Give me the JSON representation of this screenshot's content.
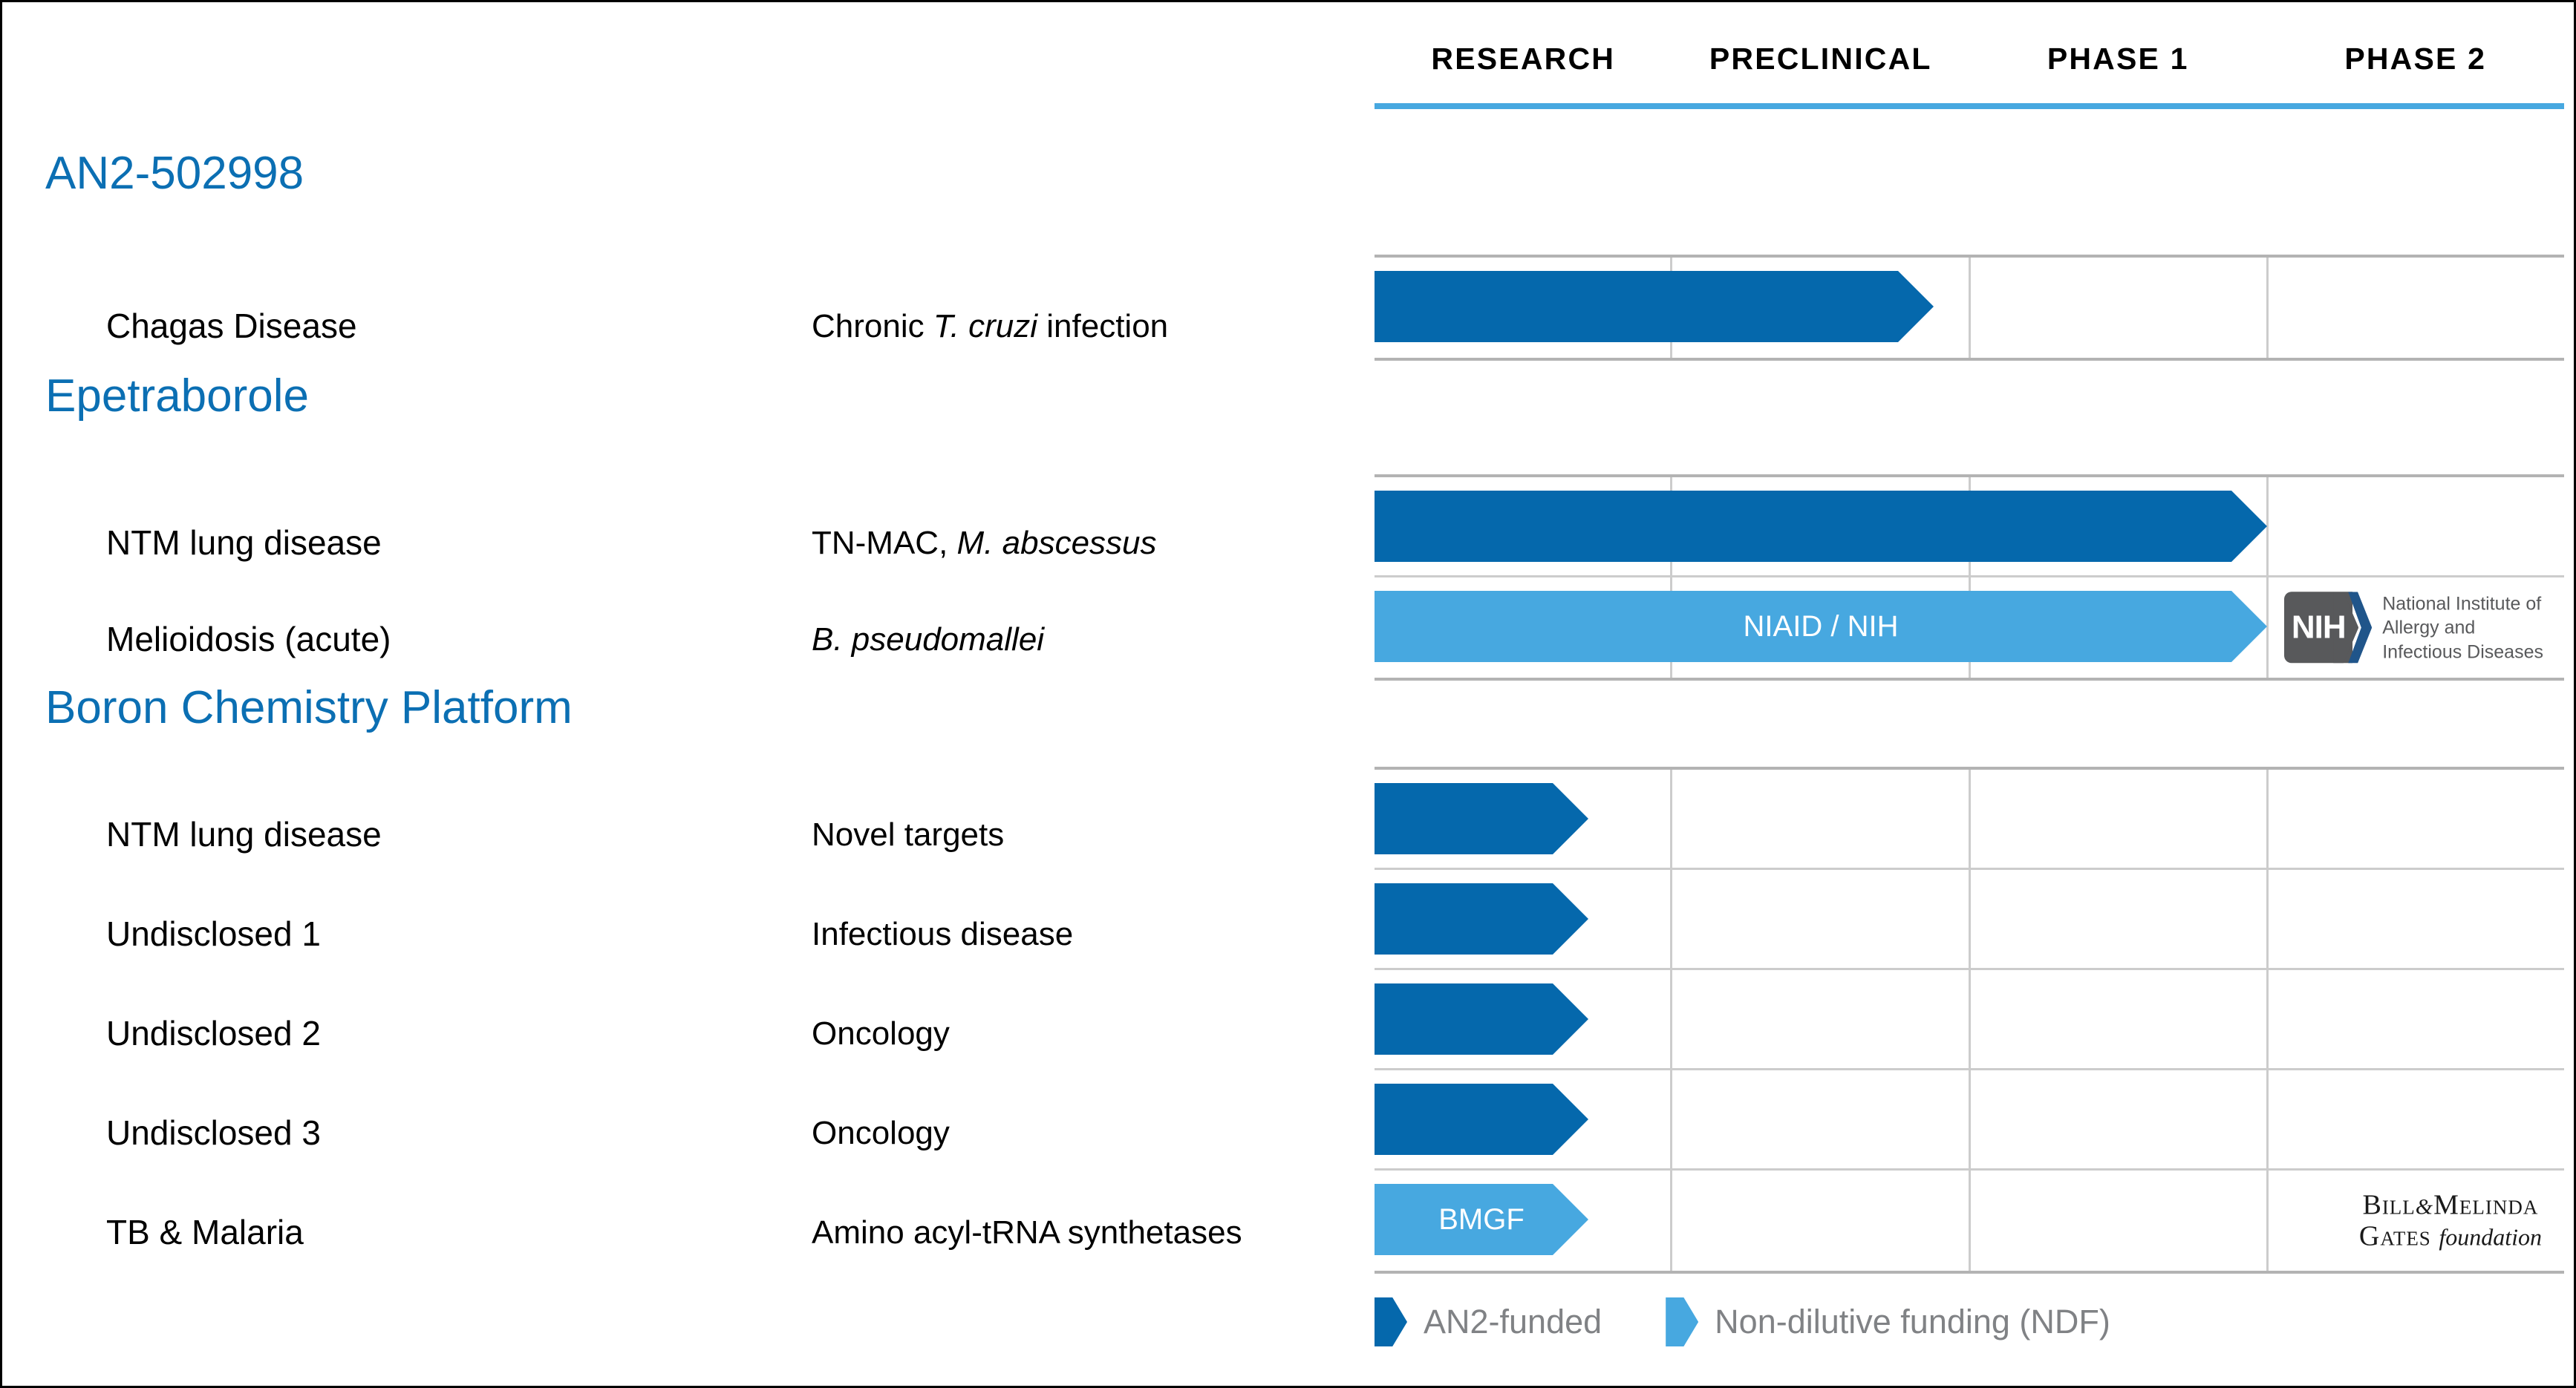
{
  "colors": {
    "an2_funded": "#0568AC",
    "non_dilutive": "#47A8E0",
    "program_title": "#0B6FB3",
    "header_underline": "#47A8E0",
    "grid_line": "#cccccc",
    "legend_text": "#808285"
  },
  "header": {
    "columns": [
      "RESEARCH",
      "PRECLINICAL",
      "PHASE 1",
      "PHASE 2"
    ]
  },
  "legend": {
    "items": [
      {
        "label": "AN2-funded",
        "color": "#0568AC"
      },
      {
        "label": "Non-dilutive funding (NDF)",
        "color": "#47A8E0"
      }
    ]
  },
  "logos": {
    "nih": {
      "badge": "NIH",
      "line1": "National Institute of",
      "line2": "Allergy and",
      "line3": "Infectious Diseases"
    },
    "gates": {
      "line1_a": "Bill",
      "line1_amp": "&",
      "line1_b": "Melinda",
      "line2_a": "Gates",
      "line2_b": "foundation"
    }
  },
  "programs": [
    {
      "title": "AN2-502998",
      "rows": [
        {
          "indication": "Chagas Disease",
          "detail_prefix": "Chronic ",
          "detail_italic": "T. cruzi",
          "detail_suffix": " infection",
          "bar": {
            "fill": "dark",
            "progress_pct": 47,
            "label": ""
          },
          "logo": ""
        }
      ]
    },
    {
      "title": "Epetraborole",
      "rows": [
        {
          "indication": "NTM lung disease",
          "detail_prefix": "TN-MAC, ",
          "detail_italic": "M. abscessus",
          "detail_suffix": "",
          "bar": {
            "fill": "dark",
            "progress_pct": 75,
            "label": ""
          },
          "logo": ""
        },
        {
          "indication": "Melioidosis (acute)",
          "detail_prefix": "",
          "detail_italic": "B. pseudomallei",
          "detail_suffix": "",
          "bar": {
            "fill": "light",
            "progress_pct": 75,
            "label": "NIAID / NIH"
          },
          "logo": "nih"
        }
      ]
    },
    {
      "title": "Boron Chemistry Platform",
      "rows": [
        {
          "indication": "NTM lung disease",
          "detail_prefix": "Novel targets",
          "detail_italic": "",
          "detail_suffix": "",
          "bar": {
            "fill": "dark",
            "progress_pct": 18,
            "label": ""
          },
          "logo": ""
        },
        {
          "indication": "Undisclosed 1",
          "detail_prefix": "Infectious disease",
          "detail_italic": "",
          "detail_suffix": "",
          "bar": {
            "fill": "dark",
            "progress_pct": 18,
            "label": ""
          },
          "logo": ""
        },
        {
          "indication": "Undisclosed 2",
          "detail_prefix": "Oncology",
          "detail_italic": "",
          "detail_suffix": "",
          "bar": {
            "fill": "dark",
            "progress_pct": 18,
            "label": ""
          },
          "logo": ""
        },
        {
          "indication": "Undisclosed 3",
          "detail_prefix": "Oncology",
          "detail_italic": "",
          "detail_suffix": "",
          "bar": {
            "fill": "dark",
            "progress_pct": 18,
            "label": ""
          },
          "logo": ""
        },
        {
          "indication": "TB & Malaria",
          "detail_prefix": "Amino acyl-tRNA synthetases",
          "detail_italic": "",
          "detail_suffix": "",
          "bar": {
            "fill": "light",
            "progress_pct": 18,
            "label": "BMGF"
          },
          "logo": "gates"
        }
      ]
    }
  ]
}
